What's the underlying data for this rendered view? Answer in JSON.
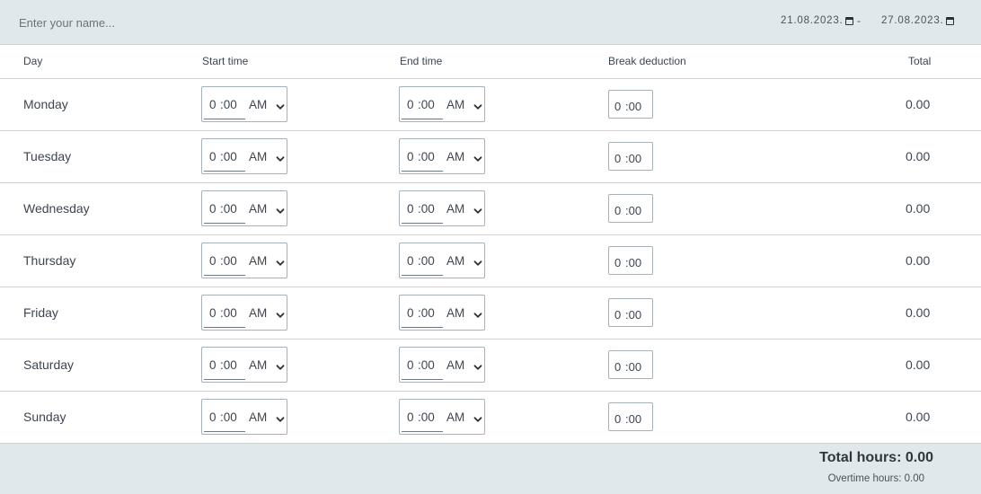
{
  "header": {
    "name_placeholder": "Enter your name...",
    "date_from": "21.08.2023.",
    "date_separator": "-",
    "date_to": "27.08.2023."
  },
  "columns": {
    "day": "Day",
    "start": "Start time",
    "end": "End time",
    "break": "Break deduction",
    "total": "Total"
  },
  "rows": [
    {
      "day": "Monday",
      "start_h": "0",
      "start_m": ":00",
      "start_ampm": "AM",
      "end_h": "0",
      "end_m": ":00",
      "end_ampm": "AM",
      "break_h": "0",
      "break_m": ":00",
      "total": "0.00"
    },
    {
      "day": "Tuesday",
      "start_h": "0",
      "start_m": ":00",
      "start_ampm": "AM",
      "end_h": "0",
      "end_m": ":00",
      "end_ampm": "AM",
      "break_h": "0",
      "break_m": ":00",
      "total": "0.00"
    },
    {
      "day": "Wednesday",
      "start_h": "0",
      "start_m": ":00",
      "start_ampm": "AM",
      "end_h": "0",
      "end_m": ":00",
      "end_ampm": "AM",
      "break_h": "0",
      "break_m": ":00",
      "total": "0.00"
    },
    {
      "day": "Thursday",
      "start_h": "0",
      "start_m": ":00",
      "start_ampm": "AM",
      "end_h": "0",
      "end_m": ":00",
      "end_ampm": "AM",
      "break_h": "0",
      "break_m": ":00",
      "total": "0.00"
    },
    {
      "day": "Friday",
      "start_h": "0",
      "start_m": ":00",
      "start_ampm": "AM",
      "end_h": "0",
      "end_m": ":00",
      "end_ampm": "AM",
      "break_h": "0",
      "break_m": ":00",
      "total": "0.00"
    },
    {
      "day": "Saturday",
      "start_h": "0",
      "start_m": ":00",
      "start_ampm": "AM",
      "end_h": "0",
      "end_m": ":00",
      "end_ampm": "AM",
      "break_h": "0",
      "break_m": ":00",
      "total": "0.00"
    },
    {
      "day": "Sunday",
      "start_h": "0",
      "start_m": ":00",
      "start_ampm": "AM",
      "end_h": "0",
      "end_m": ":00",
      "end_ampm": "AM",
      "break_h": "0",
      "break_m": ":00",
      "total": "0.00"
    }
  ],
  "footer": {
    "total_hours": "Total hours: 0.00",
    "overtime_hours": "Overtime hours: 0.00"
  },
  "icons": {
    "date_picker": "calendar-icon",
    "select_arrow": "chevron-down-icon"
  },
  "colors": {
    "header_bg": "#e1e8ec",
    "footer_bg": "#e1e8ec",
    "border": "#c9d2d8",
    "text": "#3d4550"
  }
}
